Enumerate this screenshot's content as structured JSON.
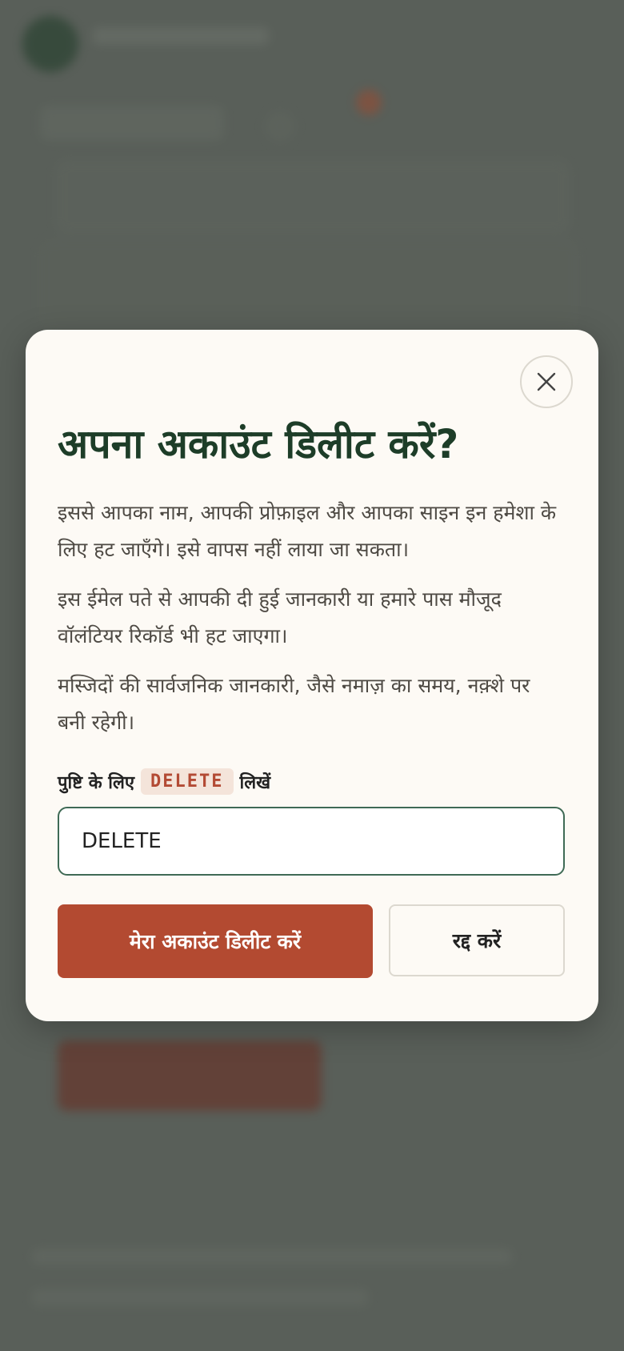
{
  "dialog": {
    "title": "अपना अकाउंट डिलीट करें?",
    "close_icon": "close-icon",
    "paragraphs": [
      "इससे आपका नाम, आपकी प्रोफ़ाइल और आपका साइन इन हमेशा के लिए हट जाएँगे। इसे वापस नहीं लाया जा सकता।",
      "इस ईमेल पते से आपकी दी हुई जानकारी या हमारे पास मौजूद वॉलंटियर रिकॉर्ड भी हट जाएगा।",
      "मस्जिदों की सार्वजनिक जानकारी, जैसे नमाज़ का समय, नक़्शे पर बनी रहेगी।"
    ],
    "confirm": {
      "prefix": "पुष्टि के लिए",
      "code": "DELETE",
      "suffix": "लिखें",
      "input_value": "DELETE"
    },
    "delete_label": "मेरा अकाउंट डिलीट करें",
    "cancel_label": "रद्द करें"
  },
  "colors": {
    "title": "#1d3d28",
    "danger": "#b34a31",
    "input_border": "#3f6a55",
    "modal_bg": "#fdfaf5",
    "overlay": "#595f59"
  }
}
